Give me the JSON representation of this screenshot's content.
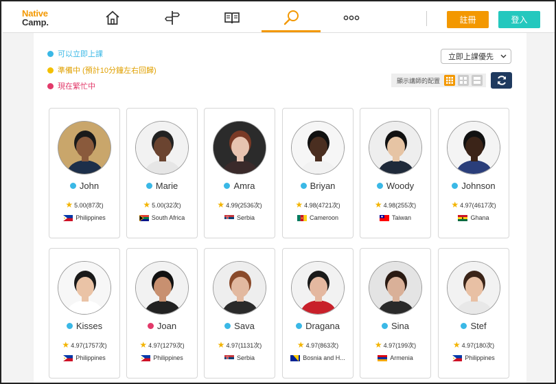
{
  "header": {
    "logo_line1": "Native",
    "logo_line2": "Camp.",
    "register_label": "註冊",
    "login_label": "登入",
    "nav_icons": [
      "home-icon",
      "signpost-icon",
      "book-icon",
      "search-icon",
      "more-icon"
    ],
    "active_nav": "search-icon"
  },
  "legend": [
    {
      "label": "可以立即上課",
      "color": "#3ab8e6"
    },
    {
      "label": "準備中 (預計10分鐘左右回歸)",
      "color": "#f3c000"
    },
    {
      "label": "現在繁忙中",
      "color": "#e23a6a"
    }
  ],
  "sort": {
    "selected": "立即上課優先"
  },
  "layout": {
    "label": "顯示講師的配置"
  },
  "colors": {
    "accent": "#f39800",
    "teal": "#24c8be",
    "available": "#3ab8e6",
    "busy": "#e23a6a",
    "refresh": "#1f3a5f"
  },
  "tutors": [
    {
      "name": "John",
      "status": "available",
      "rating": "5.00(87次)",
      "country": "Philippines",
      "flag": "ph",
      "skin": "#8a5a3c",
      "hair": "#1a1a1a",
      "shirt": "#1d2f4a",
      "bg": "#c9a66b"
    },
    {
      "name": "Marie",
      "status": "available",
      "rating": "5.00(32次)",
      "country": "South Africa",
      "flag": "za",
      "skin": "#6b4430",
      "hair": "#222",
      "shirt": "#e6e6e6",
      "bg": "#f2f2f2"
    },
    {
      "name": "Amra",
      "status": "available",
      "rating": "4.99(2536次)",
      "country": "Serbia",
      "flag": "rs",
      "skin": "#e7c3b0",
      "hair": "#7a3a26",
      "shirt": "#3a2a2a",
      "bg": "#2b2b2b"
    },
    {
      "name": "Briyan",
      "status": "available",
      "rating": "4.98(4721次)",
      "country": "Cameroon",
      "flag": "cm",
      "skin": "#4a2e20",
      "hair": "#111",
      "shirt": "#f2f2f2",
      "bg": "#f6f6f6"
    },
    {
      "name": "Woody",
      "status": "available",
      "rating": "4.98(255次)",
      "country": "Taiwan",
      "flag": "tw",
      "skin": "#e6c4a4",
      "hair": "#111",
      "shirt": "#1f2a3a",
      "bg": "#eeeeee"
    },
    {
      "name": "Johnson",
      "status": "available",
      "rating": "4.97(4617次)",
      "country": "Ghana",
      "flag": "gh",
      "skin": "#3b2418",
      "hair": "#111",
      "shirt": "#2a3e7a",
      "bg": "#f4f4f4"
    },
    {
      "name": "Kisses",
      "status": "available",
      "rating": "4.97(1757次)",
      "country": "Philippines",
      "flag": "ph",
      "skin": "#eac3a6",
      "hair": "#1a1a1a",
      "shirt": "#ffffff",
      "bg": "#f7f7f7"
    },
    {
      "name": "Joan",
      "status": "busy",
      "rating": "4.97(1279次)",
      "country": "Philippines",
      "flag": "ph",
      "skin": "#c89070",
      "hair": "#111",
      "shirt": "#222",
      "bg": "#f2f2f2"
    },
    {
      "name": "Sava",
      "status": "available",
      "rating": "4.97(1131次)",
      "country": "Serbia",
      "flag": "rs",
      "skin": "#e2b9a0",
      "hair": "#8a4a2a",
      "shirt": "#2a2a2a",
      "bg": "#eeeeee"
    },
    {
      "name": "Dragana",
      "status": "available",
      "rating": "4.97(863次)",
      "country": "Bosnia and H...",
      "flag": "ba",
      "skin": "#e4b8a0",
      "hair": "#1a1a1a",
      "shirt": "#c8202a",
      "bg": "#f2f2f2"
    },
    {
      "name": "Sina",
      "status": "available",
      "rating": "4.97(199次)",
      "country": "Armenia",
      "flag": "am",
      "skin": "#d9b098",
      "hair": "#2a1a12",
      "shirt": "#2a2a2a",
      "bg": "#e4e4e4"
    },
    {
      "name": "Stef",
      "status": "available",
      "rating": "4.97(180次)",
      "country": "Philippines",
      "flag": "ph",
      "skin": "#e8c0a4",
      "hair": "#3a2418",
      "shirt": "#e8e8e8",
      "bg": "#f2f2f2"
    }
  ]
}
